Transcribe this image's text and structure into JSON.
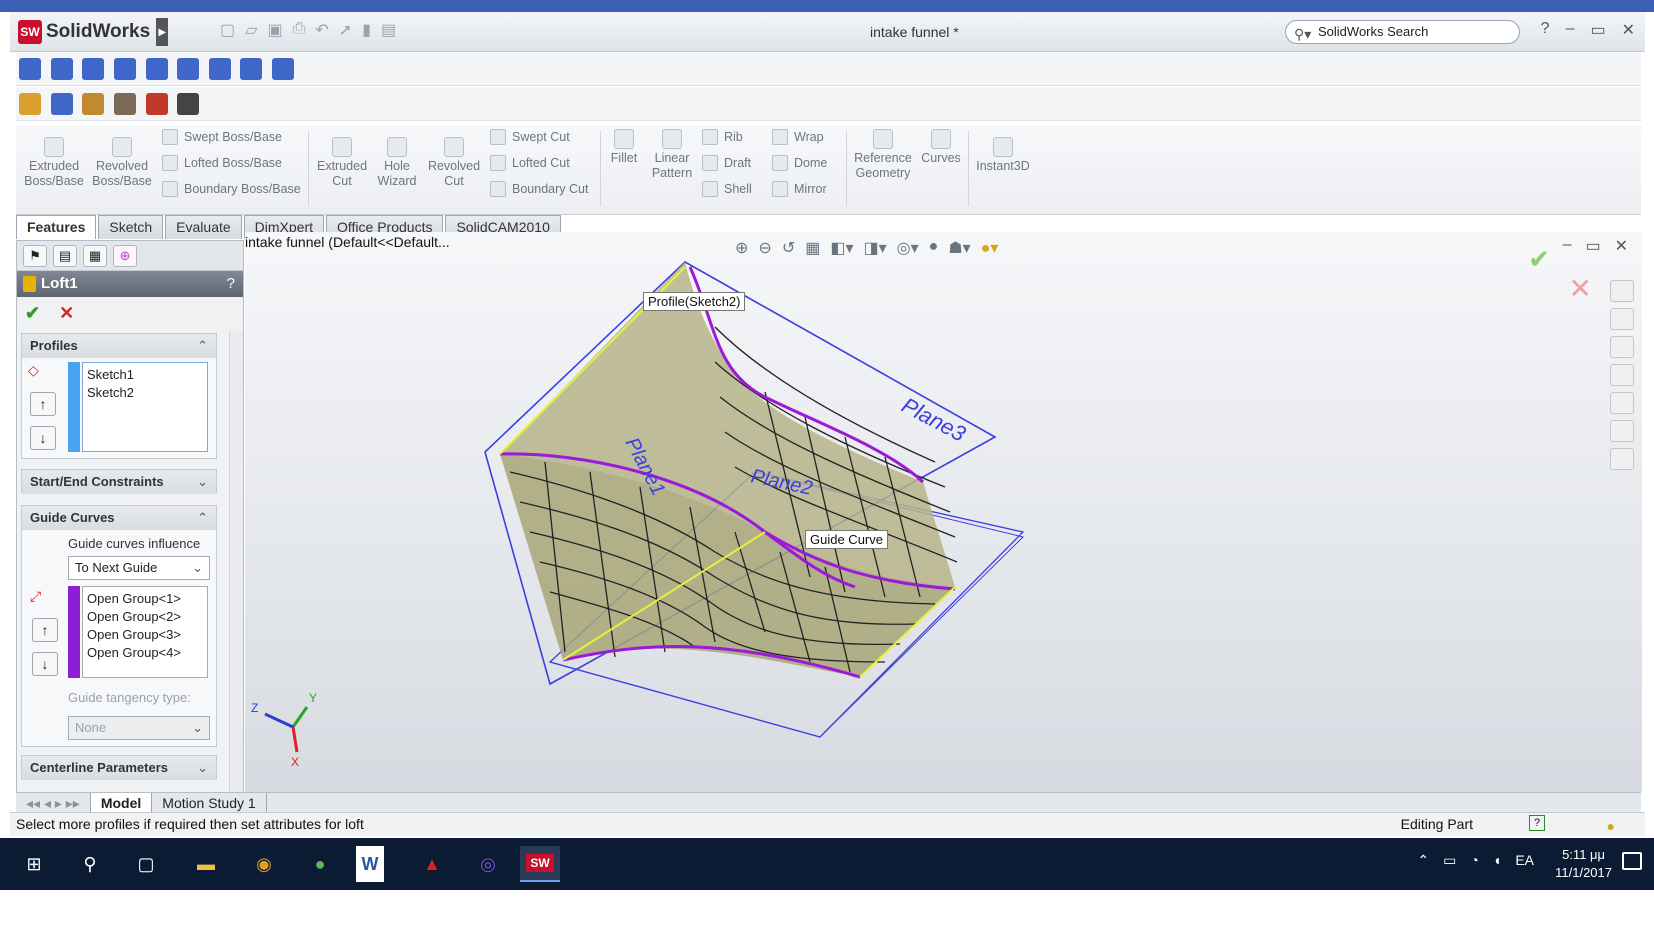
{
  "app": {
    "brand": "SolidWorks",
    "doc_title": "intake funnel *",
    "search_placeholder": "SolidWorks Search",
    "help": "?"
  },
  "commands": {
    "extruded_boss": "Extruded\nBoss/Base",
    "revolved_boss": "Revolved\nBoss/Base",
    "swept_boss": "Swept Boss/Base",
    "lofted_boss": "Lofted Boss/Base",
    "boundary_boss": "Boundary Boss/Base",
    "extruded_cut": "Extruded\nCut",
    "hole_wizard": "Hole\nWizard",
    "revolved_cut": "Revolved\nCut",
    "swept_cut": "Swept Cut",
    "lofted_cut": "Lofted Cut",
    "boundary_cut": "Boundary Cut",
    "fillet": "Fillet",
    "linear_pattern": "Linear\nPattern",
    "rib": "Rib",
    "draft": "Draft",
    "shell": "Shell",
    "wrap": "Wrap",
    "dome": "Dome",
    "mirror": "Mirror",
    "reference_geometry": "Reference\nGeometry",
    "curves": "Curves",
    "instant3d": "Instant3D"
  },
  "tabs": [
    "Features",
    "Sketch",
    "Evaluate",
    "DimXpert",
    "Office Products",
    "SolidCAM2010"
  ],
  "property_manager": {
    "title": "Loft1",
    "help": "?",
    "profiles_header": "Profiles",
    "profiles": [
      "Sketch1",
      "Sketch2"
    ],
    "start_end_header": "Start/End Constraints",
    "guide_header": "Guide Curves",
    "guide_influence_label": "Guide curves influence",
    "guide_influence_value": "To Next Guide",
    "guide_groups": [
      "Open Group<1>",
      "Open Group<2>",
      "Open Group<3>",
      "Open Group<4>"
    ],
    "tangency_label": "Guide tangency type:",
    "tangency_value": "None",
    "centerline_header": "Centerline Parameters"
  },
  "graphics": {
    "feature_tree_title": "intake funnel  (Default<<Default...",
    "callout_profile": "Profile(Sketch2)",
    "callout_guide": "Guide Curve",
    "plane_labels": [
      "Plane1",
      "Plane2",
      "Plane3"
    ],
    "triad": {
      "x": "X",
      "y": "Y",
      "z": "Z"
    }
  },
  "model_tabs": [
    "Model",
    "Motion Study 1"
  ],
  "status": {
    "message": "Select more profiles if required then set attributes for loft",
    "mode": "Editing Part"
  },
  "taskbar": {
    "lang": "EA",
    "time": "5:11 μμ",
    "date": "11/1/2017"
  },
  "colors": {
    "loft_surface": "#a8a677",
    "guide_purple": "#9b19d9",
    "plane_blue": "#3a3fe0",
    "profile_yellow": "#e6f23a"
  }
}
